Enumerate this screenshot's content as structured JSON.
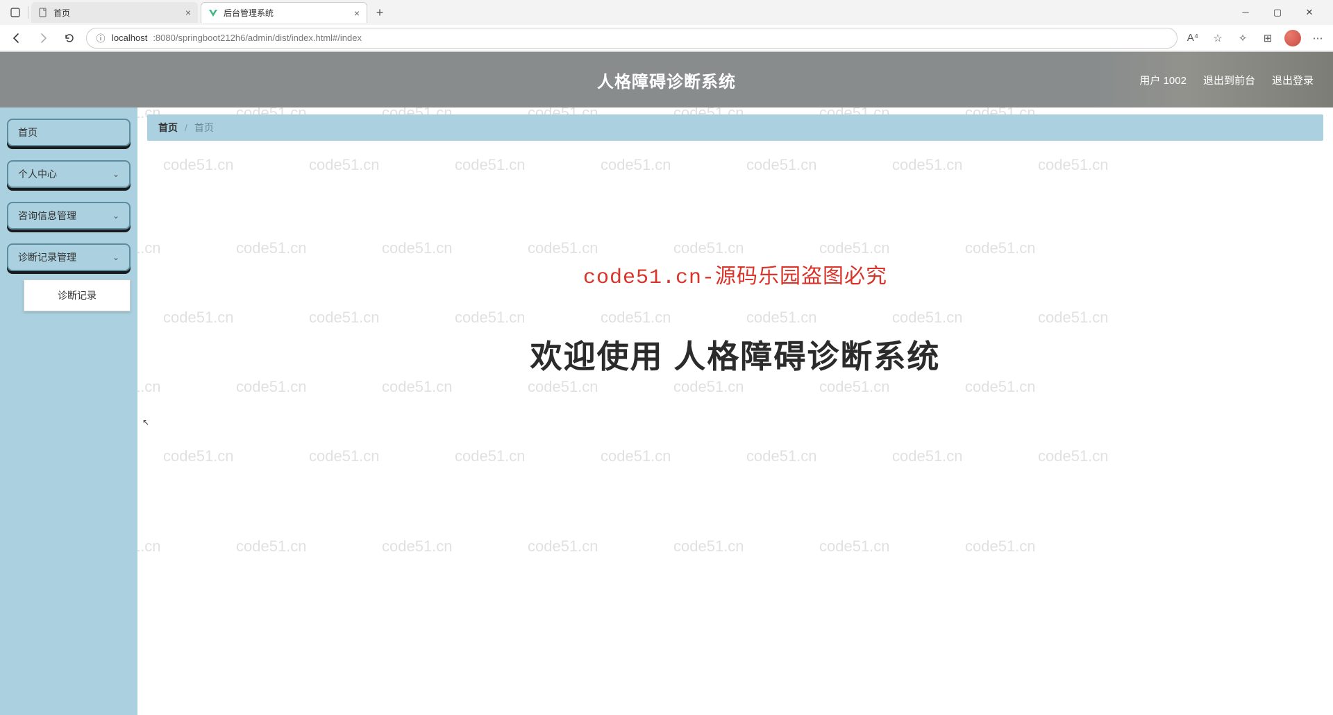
{
  "browser": {
    "tabs": [
      {
        "title": "首页",
        "active": false
      },
      {
        "title": "后台管理系统",
        "active": true
      }
    ],
    "url_host": "localhost",
    "url_path": ":8080/springboot212h6/admin/dist/index.html#/index"
  },
  "header": {
    "title": "人格障碍诊断系统",
    "user_label": "用户 1002",
    "exit_front": "退出到前台",
    "logout": "退出登录"
  },
  "sidebar": {
    "items": [
      {
        "label": "首页",
        "expandable": false
      },
      {
        "label": "个人中心",
        "expandable": true
      },
      {
        "label": "咨询信息管理",
        "expandable": true
      },
      {
        "label": "诊断记录管理",
        "expandable": true,
        "submenu": [
          "诊断记录"
        ]
      }
    ]
  },
  "breadcrumb": {
    "root": "首页",
    "current": "首页"
  },
  "content": {
    "watermark_banner": "code51.cn-源码乐园盗图必究",
    "welcome": "欢迎使用 人格障碍诊断系统"
  },
  "watermark_text": "code51.cn"
}
